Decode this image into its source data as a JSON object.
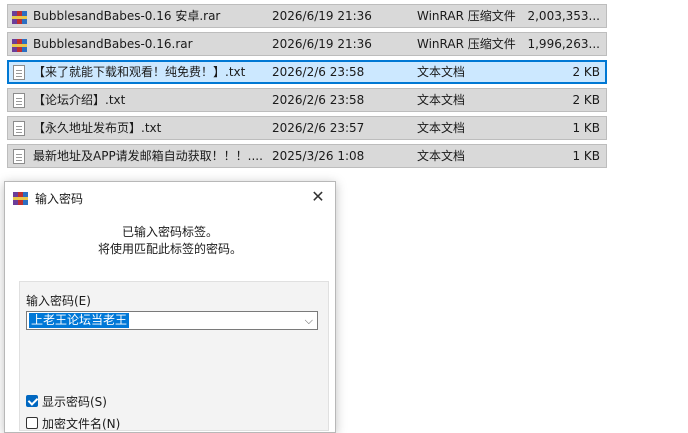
{
  "files": [
    {
      "icon": "rar-file-icon",
      "name": "BubblesandBabes-0.16 安卓.rar",
      "date": "2026/6/19 21:36",
      "type": "WinRAR 压缩文件",
      "size": "2,003,353...",
      "selected": false
    },
    {
      "icon": "rar-file-icon",
      "name": "BubblesandBabes-0.16.rar",
      "date": "2026/6/19 21:36",
      "type": "WinRAR 压缩文件",
      "size": "1,996,263...",
      "selected": false
    },
    {
      "icon": "text-file-icon",
      "name": "【来了就能下载和观看！纯免费！】.txt",
      "date": "2026/2/6 23:58",
      "type": "文本文档",
      "size": "2 KB",
      "selected": true
    },
    {
      "icon": "text-file-icon",
      "name": "【论坛介绍】.txt",
      "date": "2026/2/6 23:58",
      "type": "文本文档",
      "size": "2 KB",
      "selected": false
    },
    {
      "icon": "text-file-icon",
      "name": "【永久地址发布页】.txt",
      "date": "2026/2/6 23:57",
      "type": "文本文档",
      "size": "1 KB",
      "selected": false
    },
    {
      "icon": "text-file-icon",
      "name": "最新地址及APP请发邮箱自动获取！！！....",
      "date": "2025/3/26 1:08",
      "type": "文本文档",
      "size": "1 KB",
      "selected": false
    }
  ],
  "dialog": {
    "title": "输入密码",
    "close_glyph": "✕",
    "info_line1": "已输入密码标签。",
    "info_line2": "将使用匹配此标签的密码。",
    "password_label": "输入密码(E)",
    "password_value": "上老王论坛当老王",
    "dropdown_glyph": "⌵",
    "show_password_label": "显示密码(S)",
    "show_password_checked": true,
    "encrypt_names_label": "加密文件名(N)",
    "encrypt_names_checked": false
  },
  "colors": {
    "selection_bg": "#cce8ff",
    "selection_border": "#0078d4",
    "row_bg": "#d9d9d9",
    "input_highlight": "#0078d7",
    "checkbox_accent": "#0067c0"
  }
}
